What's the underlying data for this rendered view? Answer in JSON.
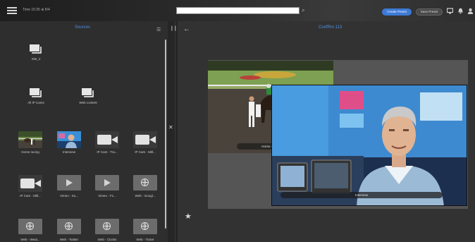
{
  "topbar": {
    "clock": "Time 15:35 ⊕ 8/4",
    "search_value": "",
    "create_preset_label": "Create Preset",
    "save_preset_label": "Save Preset",
    "icons": [
      "monitor-icon",
      "bell-icon",
      "user-icon"
    ]
  },
  "sources": {
    "title": "Sources",
    "items": [
      {
        "label": "Site_2",
        "kind": "stack"
      },
      {
        "label": "All IP Cams",
        "kind": "stack"
      },
      {
        "label": "Web content",
        "kind": "stack"
      },
      {
        "label": "Horse racing",
        "kind": "video-thumb"
      },
      {
        "label": "Interview",
        "kind": "video-thumb"
      },
      {
        "label": "IP Cam - Tra...",
        "kind": "camera"
      },
      {
        "label": "IP Cam - Mill...",
        "kind": "camera"
      },
      {
        "label": "IP Cam - Mill...",
        "kind": "camera"
      },
      {
        "label": "Vimeo - Su...",
        "kind": "play"
      },
      {
        "label": "Vimeo - F1...",
        "kind": "play"
      },
      {
        "label": "Web - Googl...",
        "kind": "web"
      },
      {
        "label": "Web - Weat...",
        "kind": "web"
      },
      {
        "label": "Web - Twitter",
        "kind": "web"
      },
      {
        "label": "Web - Clocks",
        "kind": "web"
      },
      {
        "label": "Web - Ticker",
        "kind": "web"
      }
    ]
  },
  "wall": {
    "title": "ConfRm 113",
    "windows": [
      {
        "name": "horse-racing-window",
        "caption": "Horse racing"
      },
      {
        "name": "interview-window",
        "caption": "Interview"
      }
    ]
  },
  "colors": {
    "accent": "#3d7ad6",
    "title_blue": "#4f8fe0",
    "background": "#2b2b2b"
  }
}
